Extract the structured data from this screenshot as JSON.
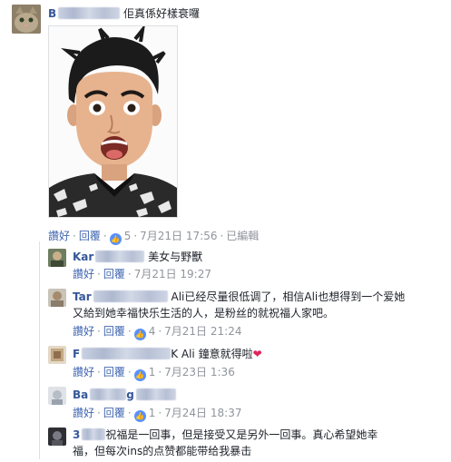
{
  "comments": [
    {
      "name_start": "B",
      "text": "佢真係好樣衰囉",
      "actions": {
        "like": "讚好",
        "reply": "回覆",
        "likes": "5",
        "time": "7月21日 17:56",
        "edited": "已編輯"
      }
    },
    {
      "name_start": "Kar",
      "text": "美女与野獸",
      "actions": {
        "like": "讚好",
        "reply": "回覆",
        "time": "7月21日 19:27"
      }
    },
    {
      "name_start": "Tar",
      "line1": "Ali已经尽量很低调了，相信Ali也想得到一个爱她",
      "line2": "又給到她幸福快乐生活的人，是粉丝的就祝福人家吧。",
      "actions": {
        "like": "讚好",
        "reply": "回覆",
        "likes": "4",
        "time": "7月21日 21:24"
      }
    },
    {
      "name_start": "F",
      "text": "K Ali 鐘意就得啦",
      "heart": "❤",
      "actions": {
        "like": "讚好",
        "reply": "回覆",
        "likes": "1",
        "time": "7月23日 1:36"
      }
    },
    {
      "name_start": "Ba",
      "name_end": "g",
      "actions": {
        "like": "讚好",
        "reply": "回覆",
        "likes": "1",
        "time": "7月24日 18:37"
      }
    },
    {
      "name_start": "3",
      "line1": "祝福是一回事，但是接受又是另外一回事。真心希望她幸",
      "line2": "福，但每次ins的点赞都能带给我暴击"
    }
  ],
  "colors": {
    "link": "#4267b2",
    "name": "#365899",
    "meta": "#90949c",
    "like_badge": "#5890ff",
    "heart": "#e0245e"
  },
  "icons": [
    "cat-avatar",
    "like-thumb-icon",
    "heart-emoji"
  ]
}
